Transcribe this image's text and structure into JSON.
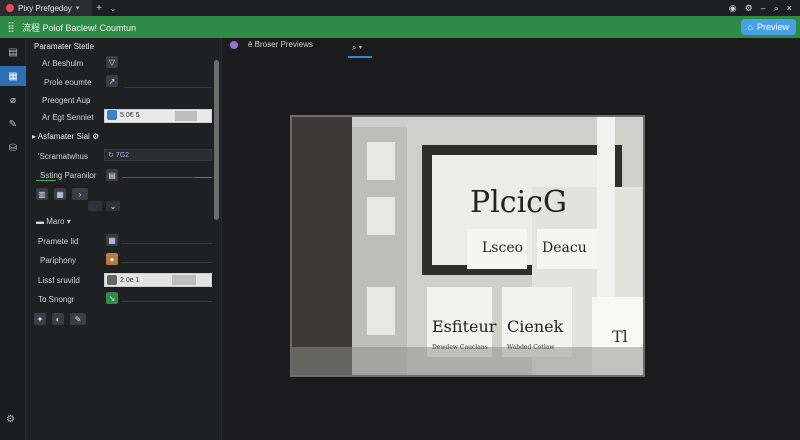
{
  "titlebar": {
    "tab_title": "Pixy Prefgedoy",
    "new_tab": "+",
    "win_controls": [
      "●",
      "⚙",
      "–",
      "□",
      "×"
    ]
  },
  "brand": {
    "title": "流程 Polof Baclew! Coumtun",
    "preview_label": "Preview"
  },
  "rail": {
    "icons": [
      "list-icon",
      "doc-icon",
      "clip-icon",
      "tag-icon",
      "bucket-icon"
    ]
  },
  "panel": {
    "section1_title": "Paramater Stetle",
    "rows": [
      {
        "label": "Ar Beshulm"
      },
      {
        "label": "Prole eoumte"
      },
      {
        "label": "Preogent Aup"
      },
      {
        "label": "Ar Egt Senniet",
        "value": "5.0€ 5"
      }
    ],
    "section2_title": "Asfamater Sial",
    "section2_marker": "⚙",
    "row2": [
      {
        "label": "'Scramatwhus",
        "value": "7G2"
      },
      {
        "label": "Sѕting Paranilor"
      }
    ],
    "more_label": "Maro",
    "rows3": [
      {
        "label": "Pramete lid"
      },
      {
        "label": "Pariphony"
      },
      {
        "label": "Lissf sruvild",
        "value": "2.0e 1"
      },
      {
        "label": "To Snongr"
      }
    ]
  },
  "viewer": {
    "tabs": [
      "ē Broser Previews"
    ],
    "tab_icon": "magnify-icon",
    "photo_texts": {
      "whiteboard": "PlcicG",
      "card1": "Lsceo",
      "card2": "Deacu",
      "card3": "Esfiteur",
      "card4": "Cienek",
      "card5": "Tl",
      "caption_left": "Dewdew Cauclans",
      "caption_right": "Wabded Cotlaw"
    }
  },
  "footer": {
    "settings_icon": "gear-icon"
  }
}
